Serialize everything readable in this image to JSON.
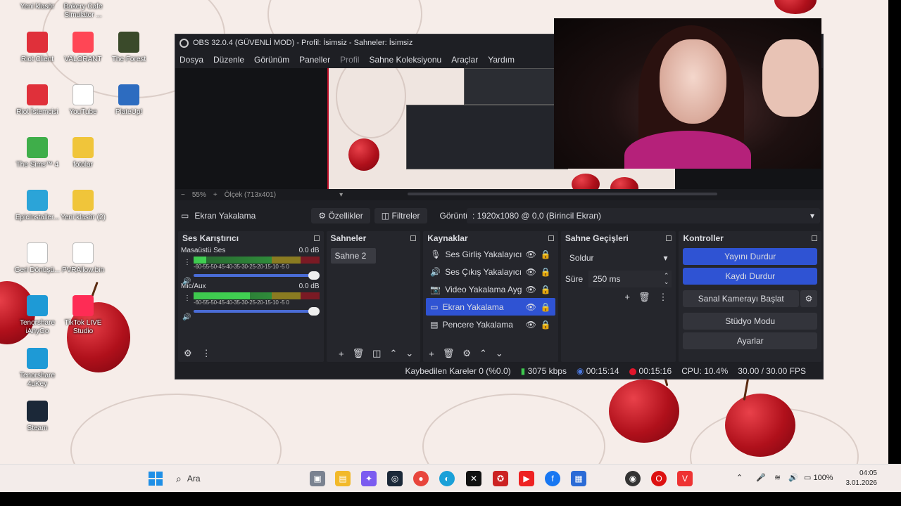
{
  "desktop_icons": [
    {
      "label": "Yeni klasör",
      "color": "#e8b32b",
      "glyph": "folder-icon"
    },
    {
      "label": "Bakery Cafe Simulator ...",
      "color": "#8c4a2f",
      "glyph": "game-icon"
    },
    {
      "label": "Riot Client",
      "color": "#e0303a",
      "glyph": "riot-icon"
    },
    {
      "label": "VALORANT",
      "color": "#ff4655",
      "glyph": "valorant-icon"
    },
    {
      "label": "The Forest",
      "color": "#3a4a2a",
      "glyph": "forest-icon"
    },
    {
      "label": "Riot İstemcisi",
      "color": "#e0303a",
      "glyph": "riot-icon"
    },
    {
      "label": "YouTube",
      "color": "#ffffff",
      "glyph": "file-icon"
    },
    {
      "label": "PlateUp!",
      "color": "#2d6cc0",
      "glyph": "plateup-icon"
    },
    {
      "label": "The Sims™ 4",
      "color": "#3fae4a",
      "glyph": "sims-icon"
    },
    {
      "label": "fotolar",
      "color": "#f0c53a",
      "glyph": "folder-icon"
    },
    {
      "label": "EpicInstaller...",
      "color": "#2ba4d8",
      "glyph": "installer-icon"
    },
    {
      "label": "Yeni klasör (2)",
      "color": "#f0c53a",
      "glyph": "folder-icon"
    },
    {
      "label": "Geri Dönüşü...",
      "color": "#ffffff",
      "glyph": "recycle-icon"
    },
    {
      "label": "PVRAllow.bin",
      "color": "#ffffff",
      "glyph": "file-icon"
    },
    {
      "label": "Tenorshare iAnyGo",
      "color": "#1e9ad6",
      "glyph": "ianygo-icon"
    },
    {
      "label": "TikTok LIVE Studio",
      "color": "#fe2c55",
      "glyph": "tiktok-icon"
    },
    {
      "label": "Tenorshare 4uKey",
      "color": "#1e9ad6",
      "glyph": "4ukey-icon"
    },
    {
      "label": "Steam",
      "color": "#1b2838",
      "glyph": "steam-icon"
    }
  ],
  "obs": {
    "title": "OBS 32.0.4 (GÜVENLİ MOD) - Profil: İsimsiz - Sahneler: İsimsiz",
    "menu": [
      "Dosya",
      "Düzenle",
      "Görünüm",
      "Paneller",
      "Profil",
      "Sahne Koleksiyonu",
      "Araçlar",
      "Yardım"
    ],
    "zoom": {
      "minus": "−",
      "value": "55%",
      "plus": "+",
      "scale": "Ölçek (713x401)"
    },
    "source_bar": {
      "source_name": "Ekran Yakalama",
      "properties": "Özellikler",
      "filters": "Filtreler",
      "display_label": "Görüntü",
      "display_value": ": 1920x1080 @ 0,0 (Birincil Ekran)"
    },
    "mixer": {
      "title": "Ses Karıştırıcı",
      "channels": [
        {
          "name": "Masaüstü Ses",
          "db": "0.0 dB",
          "level": 0.1
        },
        {
          "name": "Mic/Aux",
          "db": "0.0 dB",
          "level": 0.45
        }
      ],
      "scale": "-60-55-50-45-40-35-30-25-20-15-10 -5  0"
    },
    "scenes": {
      "title": "Sahneler",
      "items": [
        "Sahne 2"
      ]
    },
    "sources": {
      "title": "Kaynaklar",
      "items": [
        {
          "name": "Ses Girliş Yakalayıcısı",
          "icon": "mic-icon",
          "selected": false
        },
        {
          "name": "Ses Çıkış Yakalayıcısı",
          "icon": "speaker-icon",
          "selected": false
        },
        {
          "name": "Video Yakalama Aygıtı",
          "icon": "camera-icon",
          "selected": false
        },
        {
          "name": "Ekran Yakalama",
          "icon": "monitor-icon",
          "selected": true
        },
        {
          "name": "Pencere Yakalama",
          "icon": "window-icon",
          "selected": false
        }
      ]
    },
    "transitions": {
      "title": "Sahne Geçişleri",
      "type": "Soldur",
      "duration_label": "Süre",
      "duration": "250 ms"
    },
    "controls": {
      "title": "Kontroller",
      "stop_stream": "Yayını Durdur",
      "stop_record": "Kaydı Durdur",
      "virtual_cam": "Sanal Kamerayı Başlat",
      "studio_mode": "Stüdyo Modu",
      "settings": "Ayarlar"
    },
    "status": {
      "dropped": "Kaybedilen Kareler 0 (%0.0)",
      "bitrate": "3075 kbps",
      "stream_time": "00:15:14",
      "record_time": "00:15:16",
      "cpu": "CPU: 10.4%",
      "fps": "30.00 / 30.00 FPS"
    }
  },
  "taskbar": {
    "search_placeholder": "Ara",
    "battery": "100%",
    "time": "04:05",
    "date": "3.01.2026"
  }
}
